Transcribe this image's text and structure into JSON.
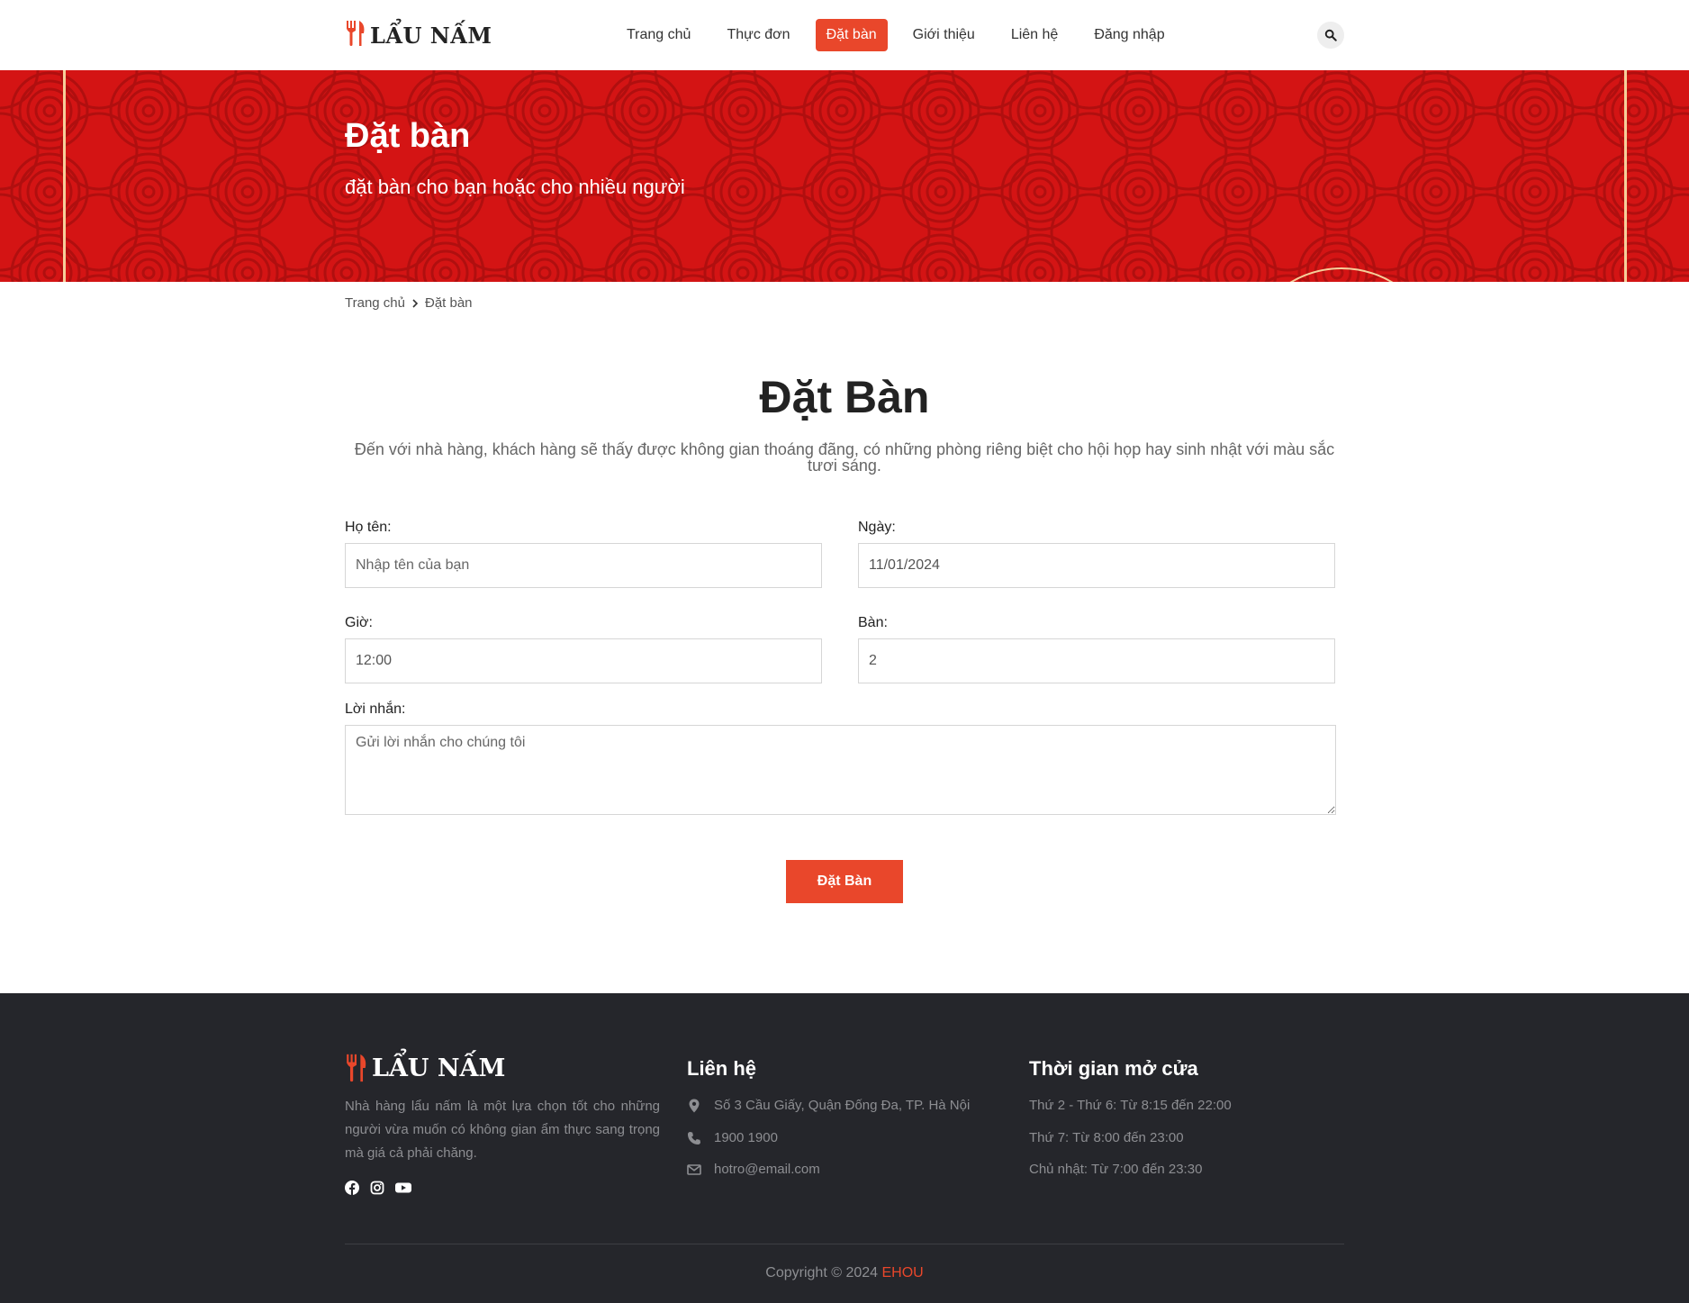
{
  "header": {
    "logo_text": "LẨU NẤM",
    "nav": [
      "Trang chủ",
      "Thực đơn",
      "Đặt bàn",
      "Giới thiệu",
      "Liên hệ",
      "Đăng nhập"
    ],
    "active_nav": "Đặt bàn"
  },
  "banner": {
    "title": "Đặt bàn",
    "subtitle": "đặt bàn cho bạn hoặc cho nhiều người"
  },
  "breadcrumb": {
    "home": "Trang chủ",
    "current": "Đặt bàn"
  },
  "main": {
    "title": "Đặt Bàn",
    "description": "Đến với nhà hàng, khách hàng sẽ thấy được không gian thoáng đãng, có những phòng riêng biệt cho hội họp hay sinh nhật với màu sắc tươi sáng."
  },
  "form": {
    "name_label": "Họ tên:",
    "name_placeholder": "Nhập tên của bạn",
    "date_label": "Ngày:",
    "date_value": "11/01/2024",
    "time_label": "Giờ:",
    "time_value": "12:00",
    "table_label": "Bàn:",
    "table_value": "2",
    "message_label": "Lời nhắn:",
    "message_placeholder": "Gửi lời nhắn cho chúng tôi",
    "submit_label": "Đặt Bàn"
  },
  "footer": {
    "logo_text": "LẨU NẤM",
    "about": "Nhà hàng lẩu nấm là một lựa chọn tốt cho những người vừa muốn có không gian ẩm thực sang trọng mà giá cả phải chăng.",
    "contact_heading": "Liên hệ",
    "address": "Số 3 Cầu Giấy, Quận Đống Đa, TP. Hà Nội",
    "phone": "1900 1900",
    "email": "hotro@email.com",
    "hours_heading": "Thời gian mở cửa",
    "hours": [
      "Thứ 2 - Thứ 6: Từ 8:15 đến 22:00",
      "Thứ 7: Từ 8:00 đến 23:00",
      "Chủ nhật: Từ 7:00 đến 23:30"
    ],
    "copyright_prefix": "Copyright © 2024",
    "copyright_brand": "EHOU"
  },
  "icons": {
    "logo": "fork-knife-icon",
    "search": "search-icon",
    "breadcrumb_separator": "chevron-right-icon",
    "address": "map-pin-icon",
    "phone": "phone-icon",
    "email": "envelope-icon",
    "socials": [
      "facebook-icon",
      "instagram-icon",
      "youtube-icon"
    ]
  },
  "colors": {
    "accent": "#e9472b",
    "banner_red": "#d41414",
    "footer_bg": "#25262b"
  }
}
